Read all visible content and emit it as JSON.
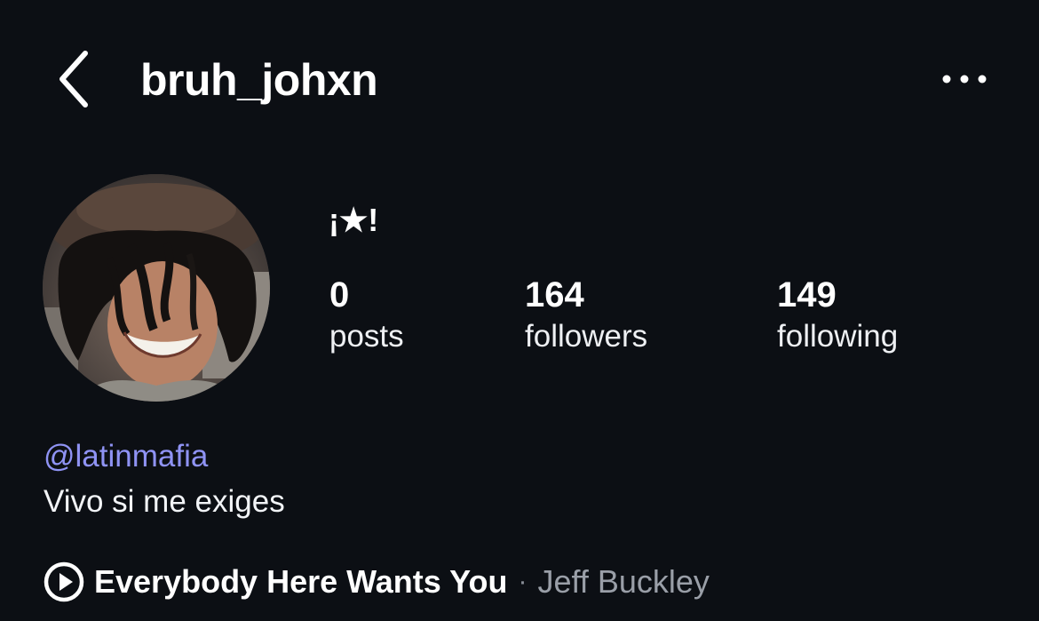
{
  "header": {
    "username": "bruh_johxn",
    "back_icon": "chevron-left-icon",
    "more_icon": "more-horizontal-icon"
  },
  "profile": {
    "display_name": "¡★!",
    "avatar_alt": "profile photo",
    "stats": [
      {
        "count": "0",
        "label": "posts"
      },
      {
        "count": "164",
        "label": "followers"
      },
      {
        "count": "149",
        "label": "following"
      }
    ],
    "mention": "@latinmafia",
    "bio": "Vivo si me exiges"
  },
  "music": {
    "icon": "play-circle-icon",
    "title": "Everybody Here Wants You",
    "separator": "·",
    "artist": "Jeff Buckley"
  },
  "colors": {
    "background": "#0c0f14",
    "mention": "#8f93f4",
    "secondary_text": "#9a9fa8"
  }
}
